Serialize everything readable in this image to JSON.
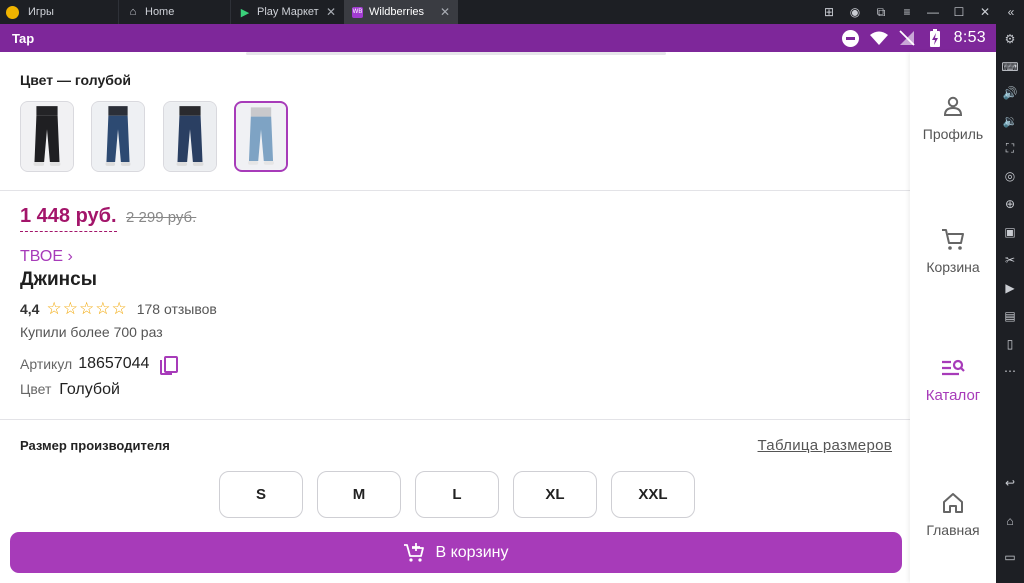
{
  "emulator": {
    "tabs": [
      {
        "label": "Игры"
      },
      {
        "label": "Home"
      },
      {
        "label": "Play Маркет"
      },
      {
        "label": "Wildberries"
      }
    ],
    "app_icon_text": "WB"
  },
  "status_bar": {
    "app": "Tap",
    "time": "8:53"
  },
  "product": {
    "color_label": "Цвет — голубой",
    "price": "1 448 руб.",
    "old_price": "2 299 руб.",
    "brand": "ТВОЕ",
    "brand_arrow": "›",
    "title": "Джинсы",
    "rating": "4,4",
    "stars_filled": 4,
    "stars_total": 5,
    "reviews": "178 отзывов",
    "bought": "Купили более 700 раз",
    "article_label": "Артикул",
    "article_value": "18657044",
    "color_line_label": "Цвет",
    "color_line_value": "Голубой",
    "thumbnails": [
      {
        "name": "black jeans",
        "color": "#1f1f22"
      },
      {
        "name": "dark blue jeans",
        "color": "#2d4a72"
      },
      {
        "name": "navy jeans",
        "color": "#2a3f62"
      },
      {
        "name": "light blue jeans",
        "color": "#7ea3c4",
        "selected": true
      }
    ]
  },
  "sizes": {
    "label": "Размер производителя",
    "table_link": "Таблица размеров",
    "options": [
      "S",
      "M",
      "L",
      "XL",
      "XXL"
    ]
  },
  "cart_button": "В корзину",
  "nav": {
    "items": [
      {
        "label": "Профиль"
      },
      {
        "label": "Корзина"
      },
      {
        "label": "Каталог",
        "active": true
      },
      {
        "label": "Главная"
      }
    ]
  },
  "colors": {
    "brand": "#a73bb9",
    "price": "#a3156a",
    "status_bar": "#7e279a"
  }
}
